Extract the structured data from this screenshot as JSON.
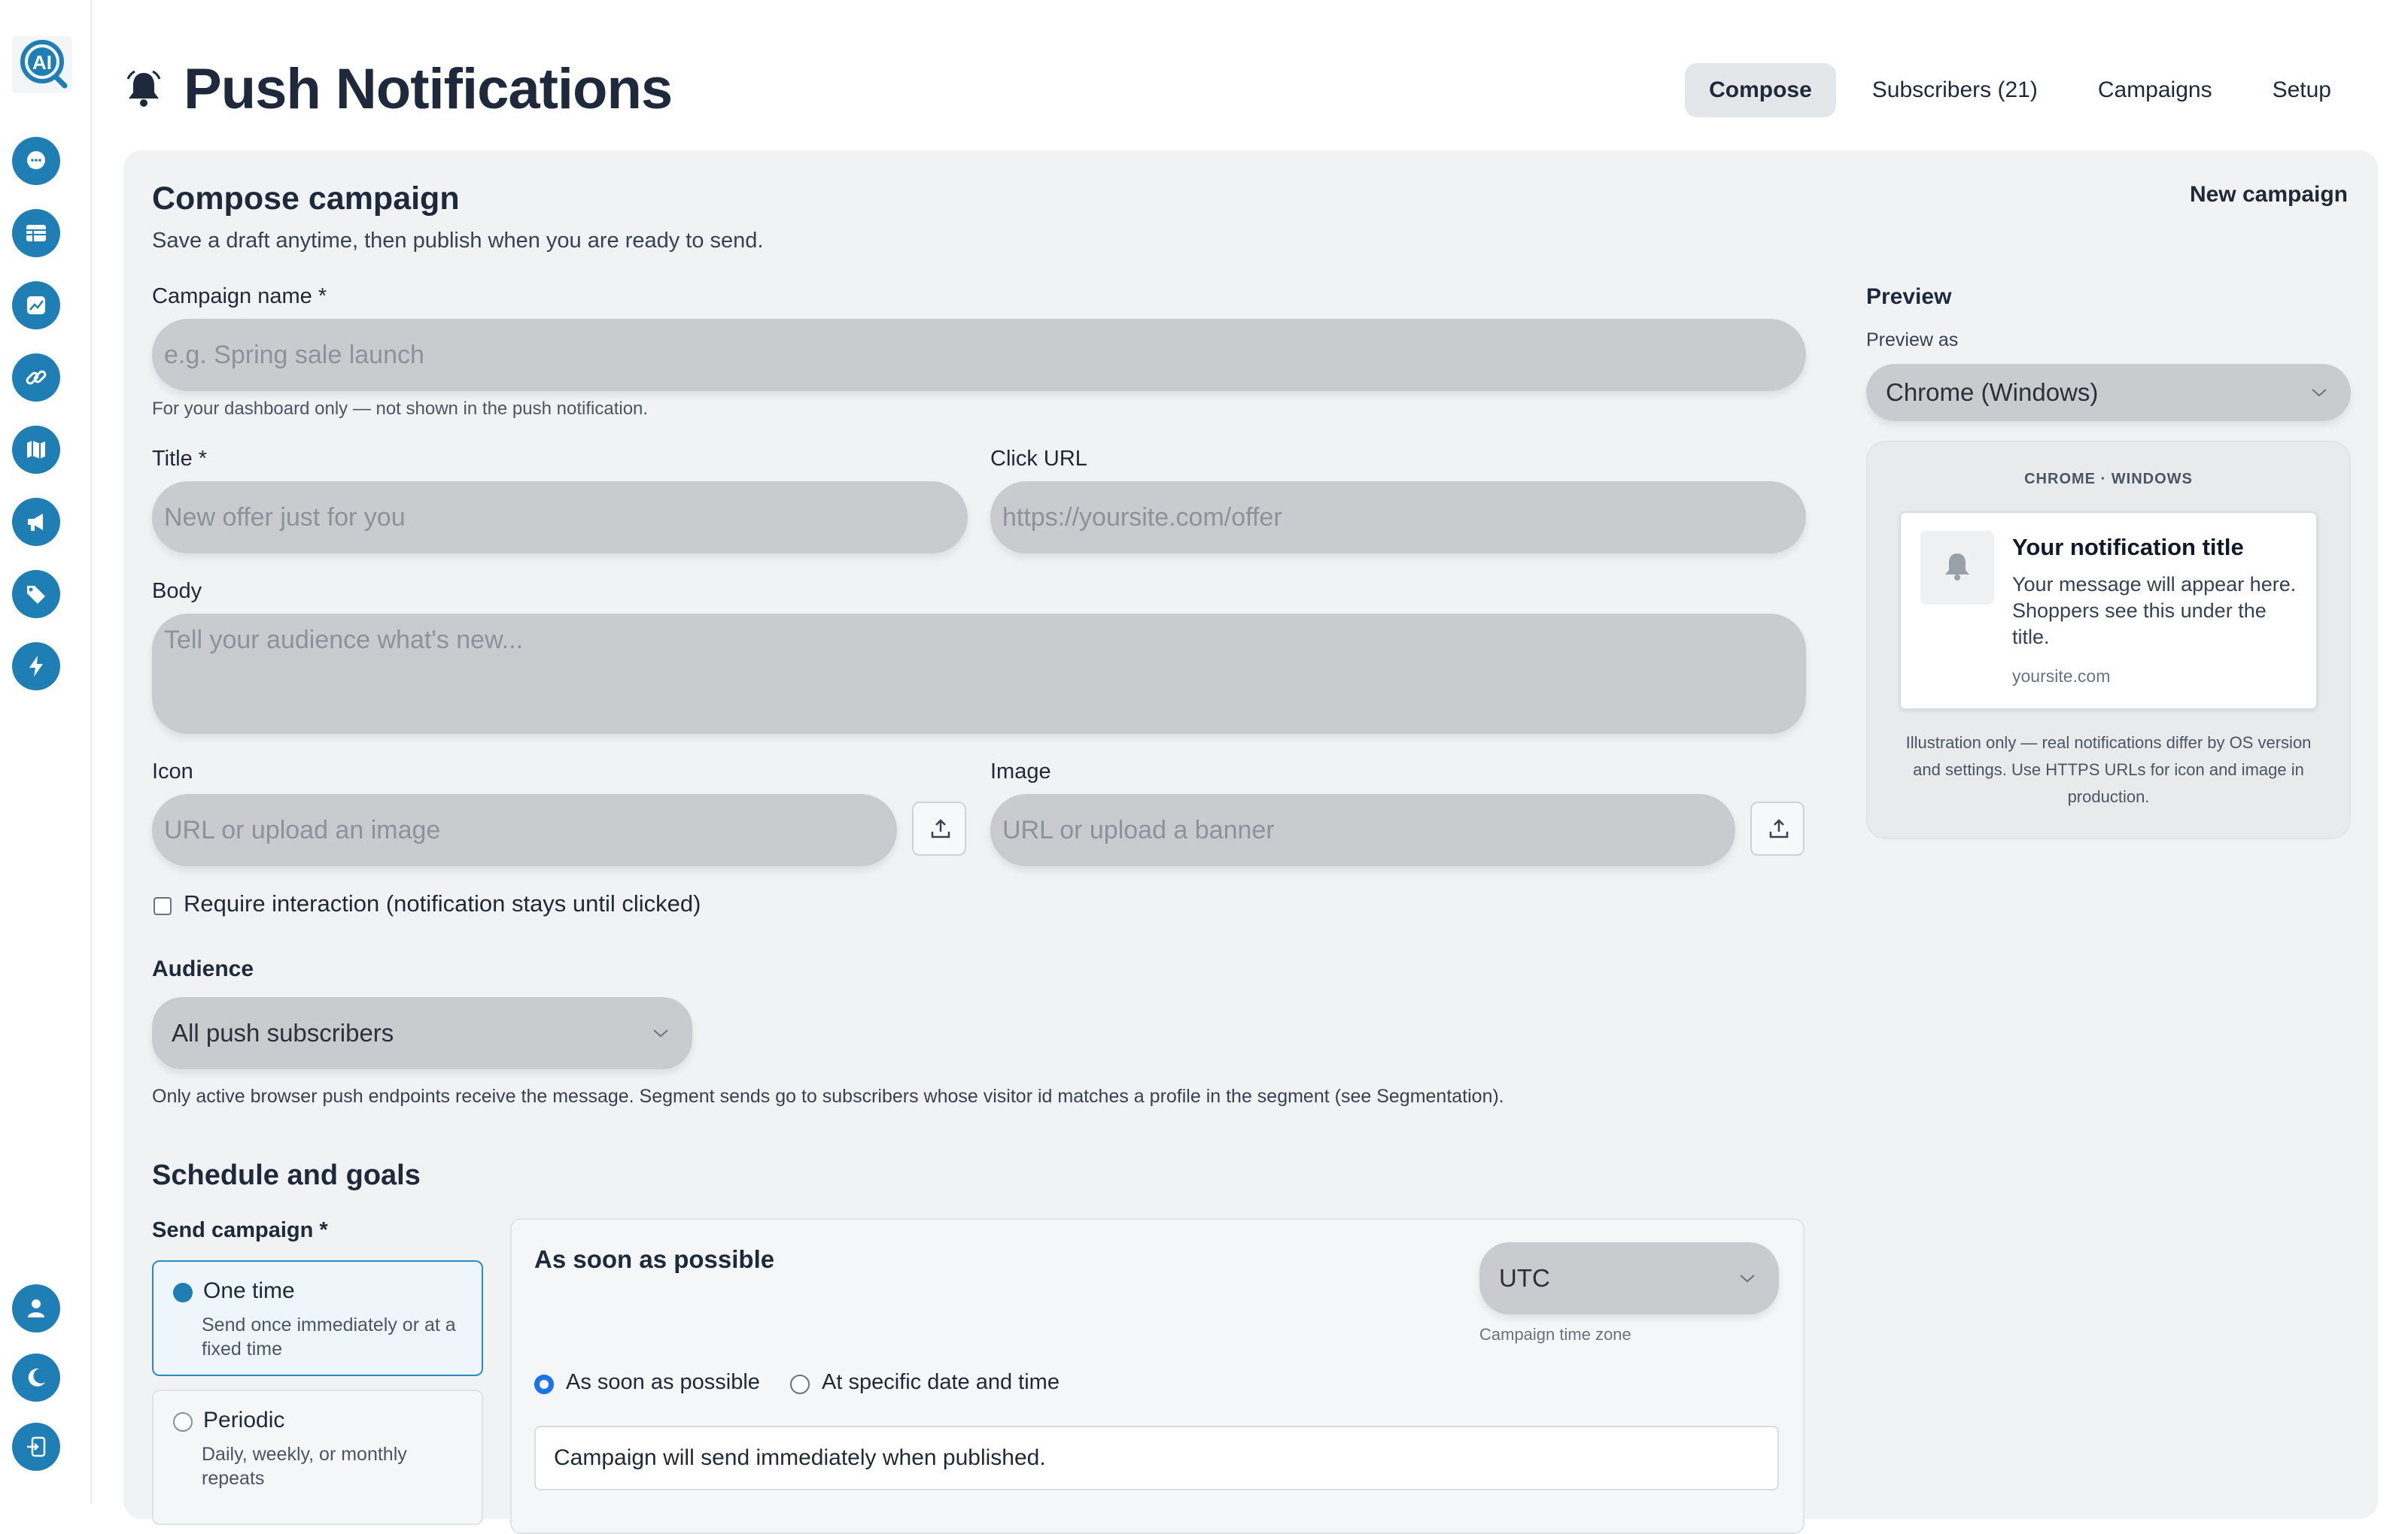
{
  "header": {
    "title": "Push Notifications",
    "tabs": [
      "Compose",
      "Subscribers (21)",
      "Campaigns",
      "Setup"
    ],
    "active_tab": "Compose"
  },
  "sidebar": {
    "logo_text": "AI",
    "top_icons": [
      "chat-bubble-icon",
      "table-icon",
      "chart-icon",
      "link-icon",
      "map-icon",
      "megaphone-icon",
      "tag-icon",
      "lightning-icon"
    ],
    "bottom_icons": [
      "user-icon",
      "moon-icon",
      "logout-icon"
    ]
  },
  "compose": {
    "title": "Compose campaign",
    "subtitle": "Save a draft anytime, then publish when you are ready to send.",
    "new_campaign": "New campaign",
    "campaign_name_label": "Campaign name *",
    "campaign_name_placeholder": "e.g. Spring sale launch",
    "campaign_name_hint": "For your dashboard only — not shown in the push notification.",
    "title_label": "Title *",
    "title_placeholder": "New offer just for you",
    "click_url_label": "Click URL",
    "click_url_placeholder": "https://yoursite.com/offer",
    "body_label": "Body",
    "body_placeholder": "Tell your audience what's new...",
    "icon_label": "Icon",
    "icon_placeholder": "URL or upload an image",
    "image_label": "Image",
    "image_placeholder": "URL or upload a banner",
    "require_interaction": "Require interaction (notification stays until clicked)",
    "audience_label": "Audience",
    "audience_value": "All push subscribers",
    "audience_hint": "Only active browser push endpoints receive the message. Segment sends go to subscribers whose visitor id matches a profile in the segment (see Segmentation)."
  },
  "preview": {
    "title": "Preview",
    "preview_as_label": "Preview as",
    "preview_as_value": "Chrome (Windows)",
    "platform_caption": "CHROME · WINDOWS",
    "notif_title": "Your notification title",
    "notif_body": "Your message will appear here. Shoppers see this under the title.",
    "notif_domain": "yoursite.com",
    "disclaimer": "Illustration only — real notifications differ by OS version and settings. Use HTTPS URLs for icon and image in production."
  },
  "schedule": {
    "title": "Schedule and goals",
    "send_label": "Send campaign *",
    "options": [
      {
        "label": "One time",
        "desc": "Send once immediately or at a fixed time",
        "selected": true
      },
      {
        "label": "Periodic",
        "desc": "Daily, weekly, or monthly repeats",
        "selected": false
      }
    ],
    "panel_title": "As soon as possible",
    "timezone_value": "UTC",
    "timezone_hint": "Campaign time zone",
    "timing_options": [
      "As soon as possible",
      "At specific date and time"
    ],
    "timing_selected": "As soon as possible",
    "status_text": "Campaign will send immediately when published."
  },
  "colors": {
    "accent": "#1f7fb4",
    "radio_blue": "#1a73e8",
    "card_bg": "#f1f2f3",
    "input_bg": "#c9cbcf"
  }
}
